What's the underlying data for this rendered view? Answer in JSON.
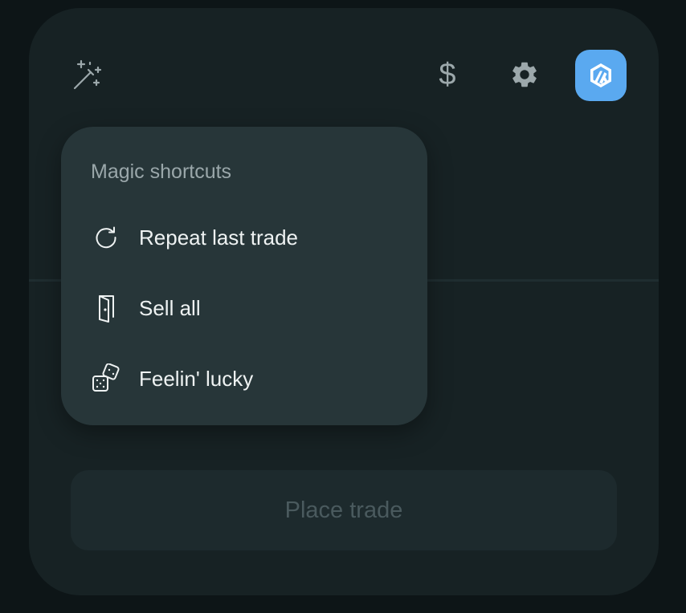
{
  "header": {
    "magic_icon": "magic-wand-icon",
    "currency_symbol": "$",
    "settings_icon": "gear-icon",
    "network_icon": "arbitrum-logo-icon",
    "colors": {
      "accent": "#5aa9f0",
      "icon": "#9ca8ab"
    }
  },
  "menu": {
    "title": "Magic shortcuts",
    "items": [
      {
        "label": "Repeat last trade",
        "icon": "refresh-icon"
      },
      {
        "label": "Sell all",
        "icon": "door-exit-icon"
      },
      {
        "label": "Feelin' lucky",
        "icon": "dice-icon"
      }
    ]
  },
  "actions": {
    "place_trade_label": "Place trade"
  }
}
